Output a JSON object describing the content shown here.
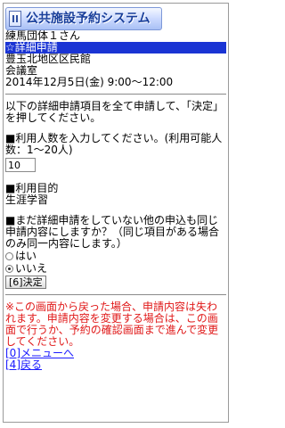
{
  "header": {
    "title": "公共施設予約システム",
    "logo_icon": "building-logo-icon"
  },
  "info": {
    "user": "練馬団体１さん",
    "step": "☆詳細申請",
    "facility": "豊玉北地区区民館",
    "room": "会議室",
    "datetime": "2014年12月5日(金) 9:00～12:00"
  },
  "instructions": "以下の詳細申請項目を全て申請して、「決定」を押してください。",
  "usage": {
    "label": "■利用人数を入力してください。(利用可能人数：1～20人)",
    "value": "10"
  },
  "purpose": {
    "label": "■利用目的",
    "value": "生涯学習"
  },
  "same_content": {
    "question": "■まだ詳細申請をしていない他の申込も同じ申請内容にしますか？（同じ項目がある場合のみ同一内容にします。）",
    "options": [
      {
        "label": "はい",
        "checked": false
      },
      {
        "label": "いいえ",
        "checked": true
      }
    ]
  },
  "submit_label": "[6]決定",
  "warning": "※この画面から戻った場合、申請内容は失われます。申請内容を変更する場合は、この画面で行うか、予約の確認画面まで進んで変更してください。",
  "links": {
    "menu": "[0]メニューへ",
    "back": "[4]戻る"
  },
  "colors": {
    "highlight": "#1a34d4",
    "warning": "#e01818",
    "link": "#1a1aff"
  }
}
